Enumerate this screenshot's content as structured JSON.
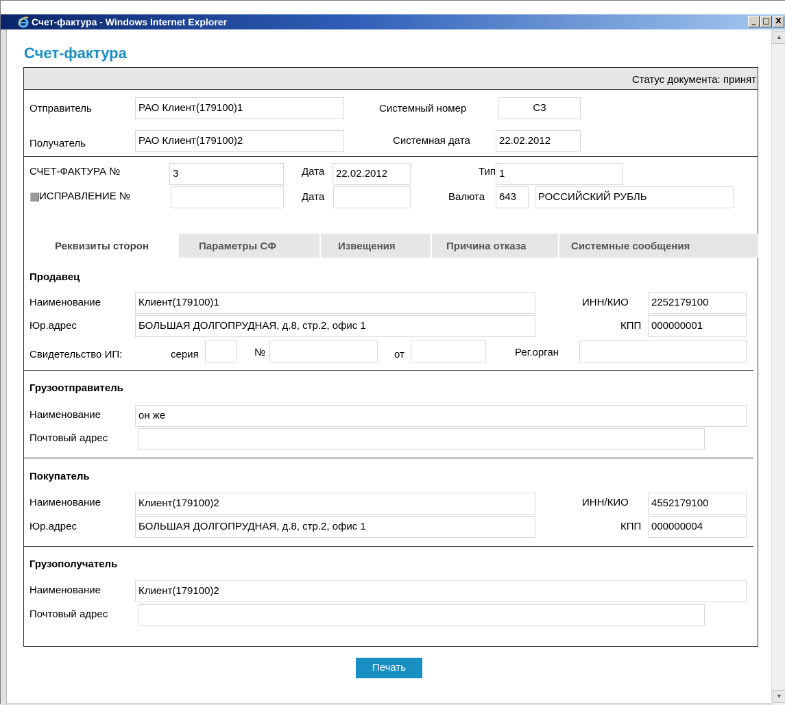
{
  "window": {
    "title": "Счет-фактура - Windows Internet Explorer",
    "minimize": "_",
    "maximize": "□",
    "close": "X"
  },
  "page": {
    "title": "Счет-фактура"
  },
  "status": {
    "text": "Статус документа: принят"
  },
  "header": {
    "sender_label": "Отправитель",
    "sender_value": "РАО Клиент(179100)1",
    "recipient_label": "Получатель",
    "recipient_value": "РАО Клиент(179100)2",
    "sysnum_label": "Системный номер",
    "sysnum_value": "С3",
    "sysdate_label": "Системная дата",
    "sysdate_value": "22.02.2012"
  },
  "invoice": {
    "number_label": "СЧЕТ-ФАКТУРА №",
    "number_value": "3",
    "date_label": "Дата",
    "date_value": "22.02.2012",
    "type_label": "Тип",
    "type_value": "1",
    "correction_label": "ИСПРАВЛЕНИЕ №",
    "correction_value": "",
    "correction_date_label": "Дата",
    "correction_date_value": "",
    "currency_label": "Валюта",
    "currency_code": "643",
    "currency_name": "РОССИЙСКИЙ РУБЛЬ"
  },
  "tabs": [
    {
      "label": "Реквизиты сторон",
      "active": true
    },
    {
      "label": "Параметры СФ"
    },
    {
      "label": "Извещения"
    },
    {
      "label": "Причина отказа"
    },
    {
      "label": "Системные сообщения"
    }
  ],
  "seller": {
    "heading": "Продавец",
    "name_label": "Наименование",
    "name_value": "Клиент(179100)1",
    "inn_label": "ИНН/КИО",
    "inn_value": "2252179100",
    "address_label": "Юр.адрес",
    "address_value": "БОЛЬШАЯ ДОЛГОПРУДНАЯ, д.8, стр.2, офис 1",
    "kpp_label": "КПП",
    "kpp_value": "000000001",
    "cert_label": "Свидетельство ИП:",
    "series_label": "серия",
    "series_value": "",
    "num_label": "№",
    "num_value": "",
    "from_label": "от",
    "from_value": "",
    "regorgan_label": "Рег.орган",
    "regorgan_value": ""
  },
  "shipper": {
    "heading": "Грузоотправитель",
    "name_label": "Наименование",
    "name_value": "он же",
    "postal_label": "Почтовый адрес",
    "postal_value": ""
  },
  "buyer": {
    "heading": "Покупатель",
    "name_label": "Наименование",
    "name_value": "Клиент(179100)2",
    "inn_label": "ИНН/КИО",
    "inn_value": "4552179100",
    "address_label": "Юр.адрес",
    "address_value": "БОЛЬШАЯ ДОЛГОПРУДНАЯ, д.8, стр.2, офис 1",
    "kpp_label": "КПП",
    "kpp_value": "000000004"
  },
  "consignee": {
    "heading": "Грузополучатель",
    "name_label": "Наименование",
    "name_value": "Клиент(179100)2",
    "postal_label": "Почтовый адрес",
    "postal_value": ""
  },
  "actions": {
    "print_label": "Печать"
  },
  "colors": {
    "accent": "#1a8fc4",
    "tab_bg": "#e6e6e6"
  },
  "icons": {
    "browser": "ie-icon",
    "scroll_up": "scroll-up-icon",
    "scroll_down": "scroll-down-icon"
  }
}
